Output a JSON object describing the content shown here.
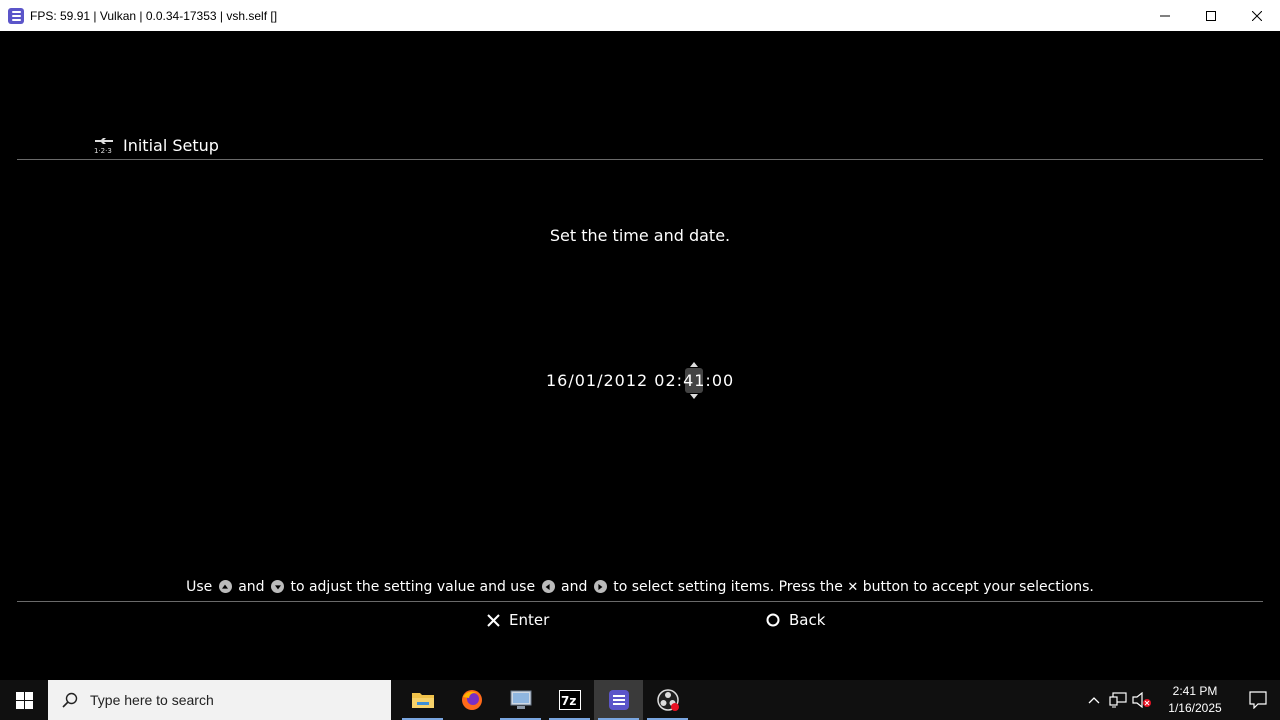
{
  "window": {
    "title": "FPS: 59.91 | Vulkan | 0.0.34-17353 | vsh.self []",
    "icon": "rpcs3-icon"
  },
  "setup": {
    "header_title": "Initial Setup",
    "header_icon": "tools-123-icon",
    "prompt": "Set the time and date.",
    "datetime": {
      "before": "16/01/2012 02:",
      "selected": "41",
      "after": ":00"
    },
    "instructions": {
      "use": "Use",
      "and1": "and",
      "adjust": "to adjust the setting value and use",
      "and2": "and",
      "select": "to select setting items. Press the",
      "accept": "button to accept your selections."
    },
    "actions": {
      "enter_label": "Enter",
      "back_label": "Back"
    }
  },
  "taskbar": {
    "search_placeholder": "Type here to search",
    "apps": [
      "file-explorer-icon",
      "firefox-icon",
      "remote-desktop-icon",
      "7zip-icon",
      "rpcs3-icon",
      "obs-icon"
    ],
    "clock_time": "2:41 PM",
    "clock_date": "1/16/2025"
  },
  "colors": {
    "accent": "#5b55c9",
    "background": "#000000"
  }
}
